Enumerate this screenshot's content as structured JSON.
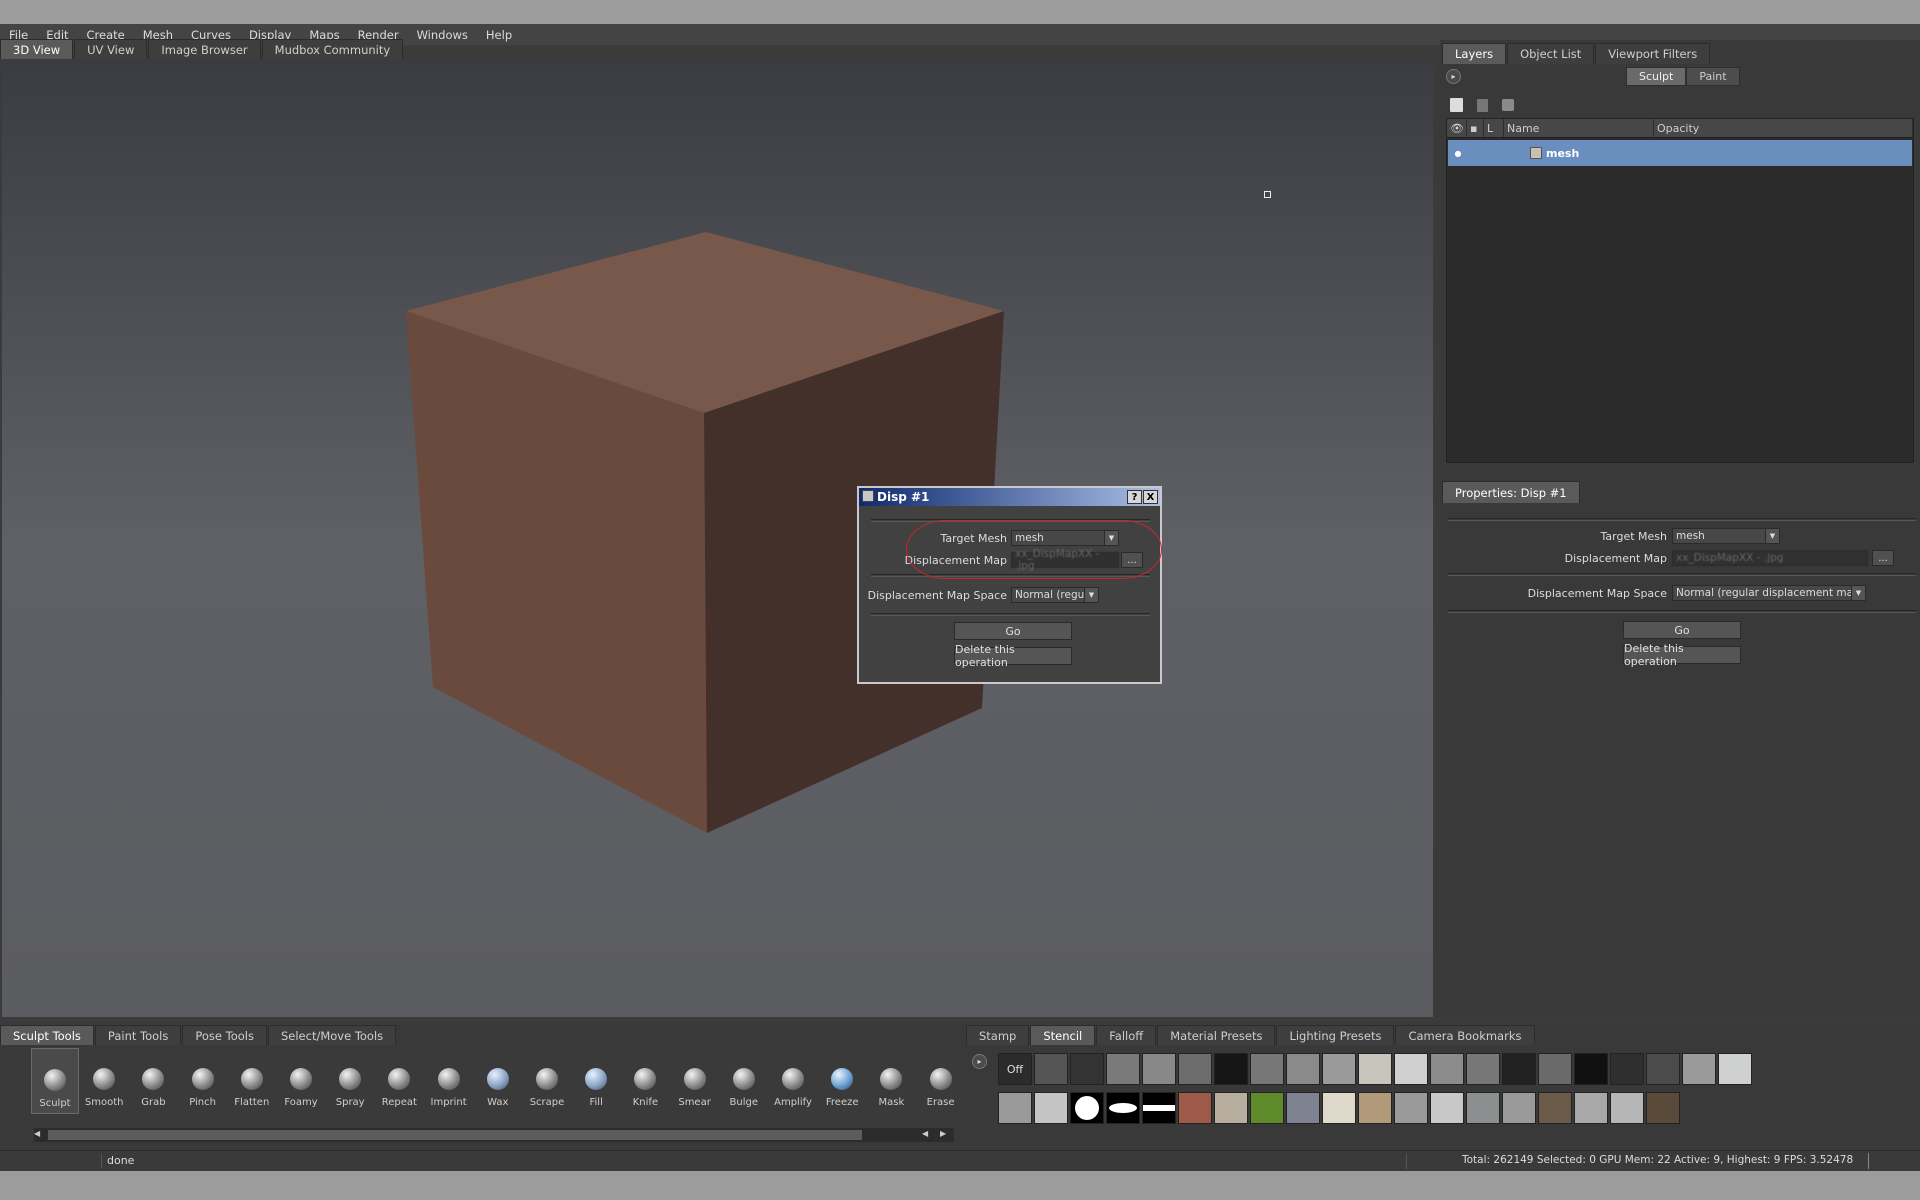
{
  "menu": [
    "File",
    "Edit",
    "Create",
    "Mesh",
    "Curves",
    "Display",
    "Maps",
    "Render",
    "Windows",
    "Help"
  ],
  "view_tabs": [
    "3D View",
    "UV View",
    "Image Browser",
    "Mudbox Community"
  ],
  "right_tabs": [
    "Layers",
    "Object List",
    "Viewport Filters"
  ],
  "layer_mode": {
    "sculpt": "Sculpt",
    "paint": "Paint"
  },
  "layers": {
    "columns": {
      "lock": "L",
      "name": "Name",
      "opacity": "Opacity"
    },
    "rows": [
      {
        "name": "mesh"
      }
    ]
  },
  "properties": {
    "tab_label": "Properties: Disp #1",
    "target_mesh_label": "Target Mesh",
    "target_mesh_value": "mesh",
    "disp_map_label": "Displacement Map",
    "disp_map_value": "xx_DispMapXX - .jpg",
    "browse_label": "...",
    "space_label": "Displacement Map Space",
    "space_value": "Normal (regular displacement map)",
    "go_label": "Go",
    "delete_label": "Delete this operation"
  },
  "dialog": {
    "title": "Disp #1",
    "help": "?",
    "close": "X",
    "target_mesh_label": "Target Mesh",
    "target_mesh_value": "mesh",
    "disp_map_label": "Displacement Map",
    "disp_map_value": "xx_DispMapXX - .jpg",
    "browse_label": "...",
    "space_label": "Displacement Map Space",
    "space_value": "Normal (regul",
    "go_label": "Go",
    "delete_label": "Delete this operation"
  },
  "tool_tabs": [
    "Sculpt Tools",
    "Paint Tools",
    "Pose Tools",
    "Select/Move Tools"
  ],
  "tools": [
    "Sculpt",
    "Smooth",
    "Grab",
    "Pinch",
    "Flatten",
    "Foamy",
    "Spray",
    "Repeat",
    "Imprint",
    "Wax",
    "Scrape",
    "Fill",
    "Knife",
    "Smear",
    "Bulge",
    "Amplify",
    "Freeze",
    "Mask",
    "Erase"
  ],
  "stamp_tabs": [
    "Stamp",
    "Stencil",
    "Falloff",
    "Material Presets",
    "Lighting Presets",
    "Camera Bookmarks"
  ],
  "stamp_off_label": "Off",
  "status": {
    "message": "done",
    "stats": "Total: 262149  Selected: 0 GPU Mem: 22  Active: 9, Highest: 9  FPS: 3.52478"
  },
  "colors": {
    "cube_top": "#77584a",
    "cube_left": "#6b4b3d",
    "cube_right": "#44302a",
    "selection": "#6a8fbf",
    "annotation": "#d2232a"
  }
}
